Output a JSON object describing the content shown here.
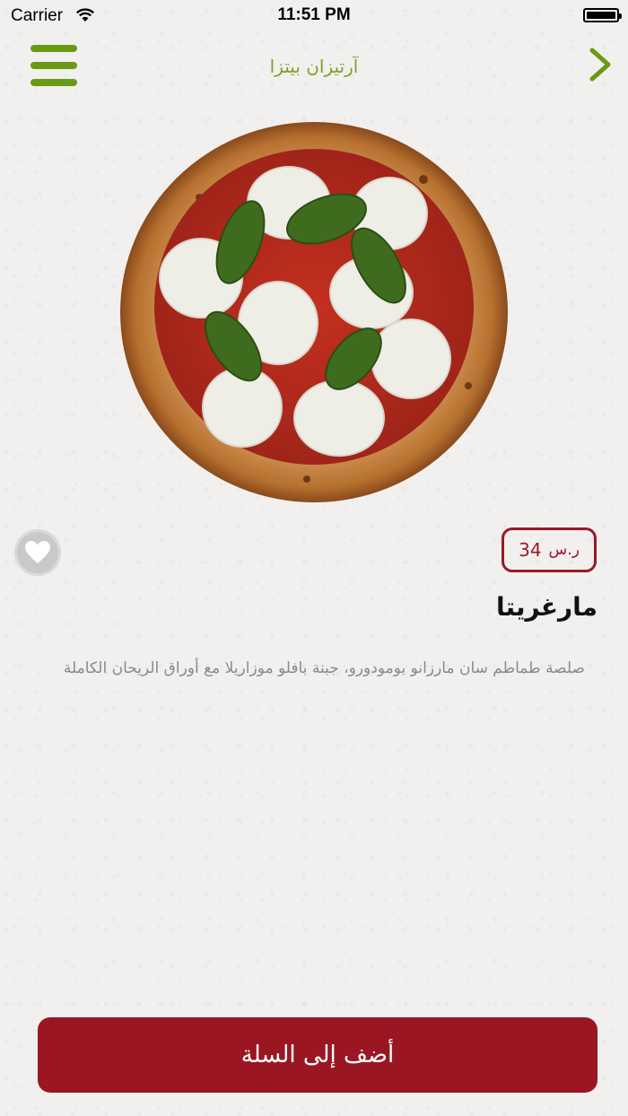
{
  "status_bar": {
    "carrier": "Carrier",
    "time": "11:51 PM"
  },
  "nav": {
    "title": "آرتيزان بيتزا",
    "menu_icon": "hamburger-menu-icon",
    "back_icon": "chevron-right-icon",
    "accent_color": "#6a9a15"
  },
  "product": {
    "image": "pizza-margherita-image",
    "price_value": "34",
    "price_currency": "ر.س",
    "name": "مارغريتا",
    "description": "صلصة طماطم سان مارزانو بومودورو، جبنة بافلو موزاريلا مع أوراق الريحان الكاملة",
    "favorite_icon": "heart-icon"
  },
  "actions": {
    "add_to_cart_label": "أضف إلى السلة",
    "button_color": "#9b1623"
  }
}
